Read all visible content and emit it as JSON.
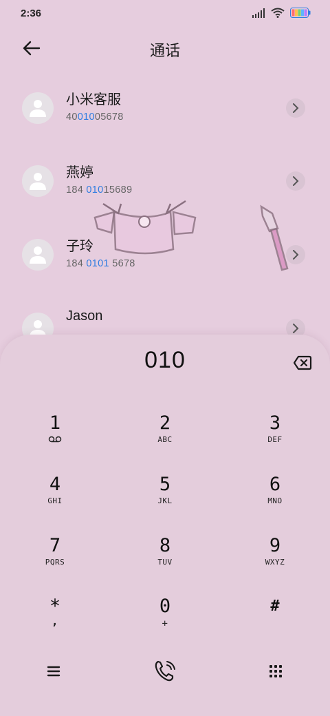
{
  "status_bar": {
    "time": "2:36",
    "icons": [
      "signal-icon",
      "wifi-icon",
      "battery-icon"
    ]
  },
  "header": {
    "back_icon": "arrow-left-icon",
    "title": "通话"
  },
  "contacts": [
    {
      "name": "小米客服",
      "number_pre": "40",
      "number_hl": "010",
      "number_post": "05678"
    },
    {
      "name": "燕婷",
      "number_pre": "184 ",
      "number_hl": "010",
      "number_post": "15689"
    },
    {
      "name": "子玲",
      "number_pre": "184 ",
      "number_hl": "0101",
      "number_post": " 5678"
    },
    {
      "name": "Jason",
      "number_pre": "",
      "number_hl": "",
      "number_post": ""
    }
  ],
  "dialer": {
    "input_value": "010",
    "keys": [
      {
        "digit": "1",
        "letters": "voicemail-icon"
      },
      {
        "digit": "2",
        "letters": "ABC"
      },
      {
        "digit": "3",
        "letters": "DEF"
      },
      {
        "digit": "4",
        "letters": "GHI"
      },
      {
        "digit": "5",
        "letters": "JKL"
      },
      {
        "digit": "6",
        "letters": "MNO"
      },
      {
        "digit": "7",
        "letters": "PQRS"
      },
      {
        "digit": "8",
        "letters": "TUV"
      },
      {
        "digit": "9",
        "letters": "WXYZ"
      },
      {
        "digit": "*",
        "letters": ","
      },
      {
        "digit": "0",
        "letters": "+"
      },
      {
        "digit": "#",
        "letters": ""
      }
    ],
    "bottom_icons": [
      "menu-icon",
      "call-icon",
      "keypad-icon"
    ]
  },
  "colors": {
    "background": "#e6cdde",
    "highlight": "#2f7de1",
    "avatar": "#e6e1e6"
  }
}
